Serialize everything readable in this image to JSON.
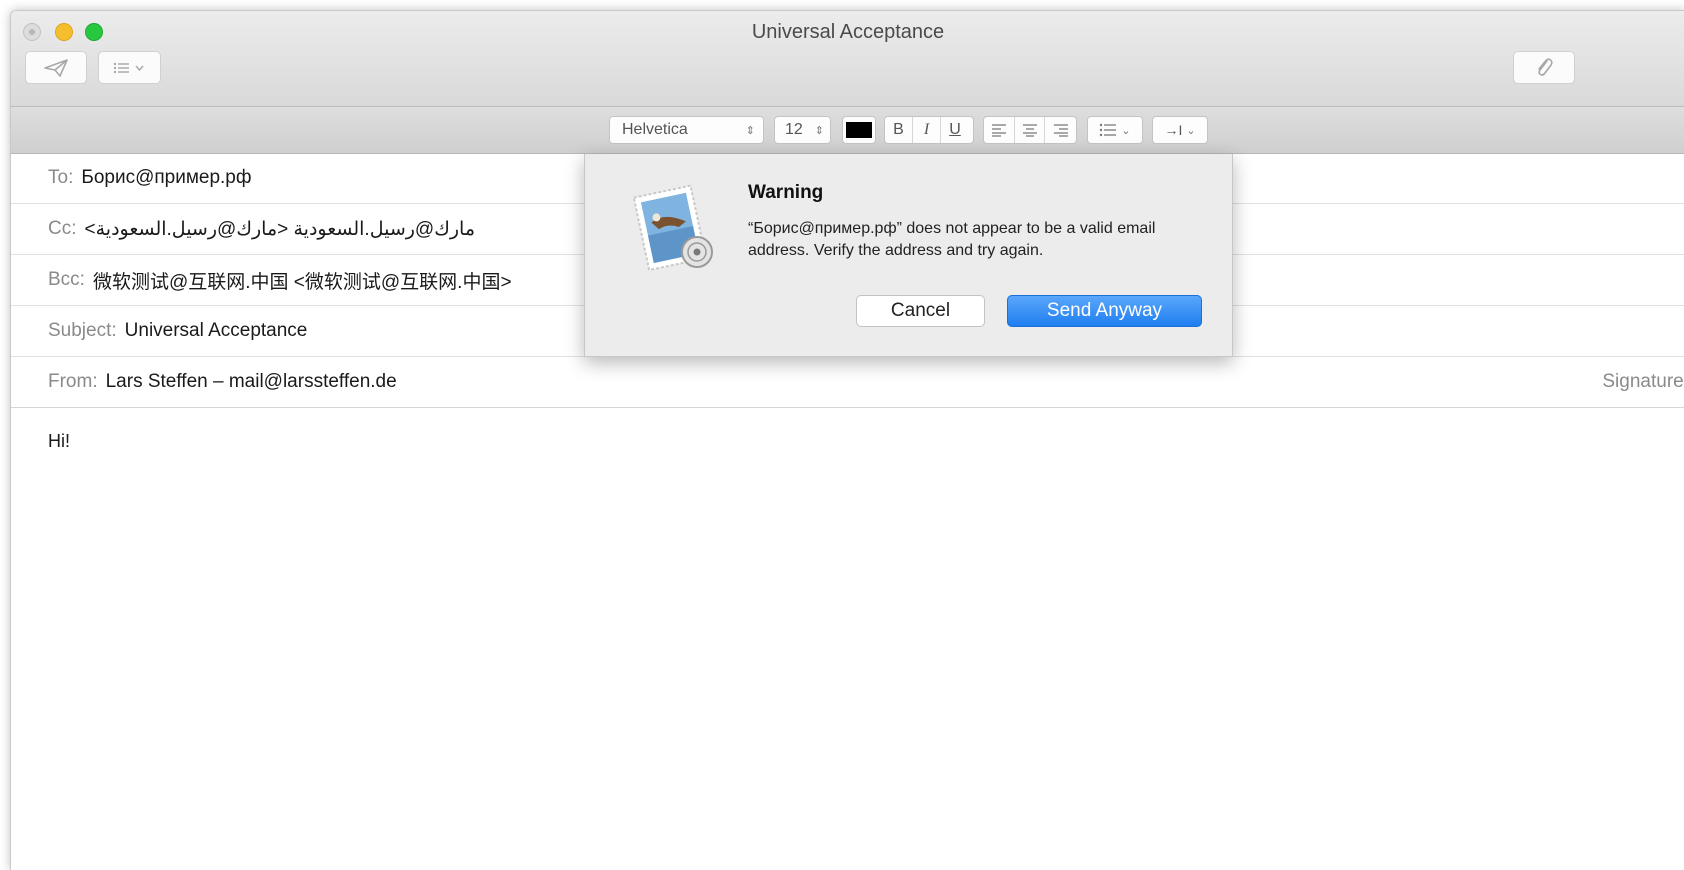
{
  "window": {
    "title": "Universal Acceptance"
  },
  "toolbar": {
    "send_icon": "paper-plane-icon",
    "list_icon": "header-fields-icon",
    "attach_icon": "paperclip-icon"
  },
  "format_bar": {
    "font": "Helvetica",
    "size": "12",
    "color": "#000000",
    "bold": "B",
    "italic": "I",
    "underline": "U",
    "indent_label": "→I"
  },
  "compose": {
    "to_label": "To:",
    "to_value": "Борис@пример.рф",
    "cc_label": "Cc:",
    "cc_value": "مارك@رسيل.السعودية <مارك@رسيل.السعودية>",
    "bcc_label": "Bcc:",
    "bcc_value": "微软测试@互联网.中国 <微软测试@互联网.中国>",
    "subject_label": "Subject:",
    "subject_value": "Universal Acceptance",
    "from_label": "From:",
    "from_value": "Lars Steffen – mail@larssteffen.de",
    "signature_label": "Signature:",
    "body": "Hi!"
  },
  "dialog": {
    "title": "Warning",
    "message": "“Борис@пример.рф” does not appear to be a valid email address. Verify the address and try again.",
    "cancel_label": "Cancel",
    "send_label": "Send Anyway"
  },
  "colors": {
    "accent": "#1f7ef0",
    "minimize": "#f5be2d",
    "zoom": "#27c840"
  }
}
